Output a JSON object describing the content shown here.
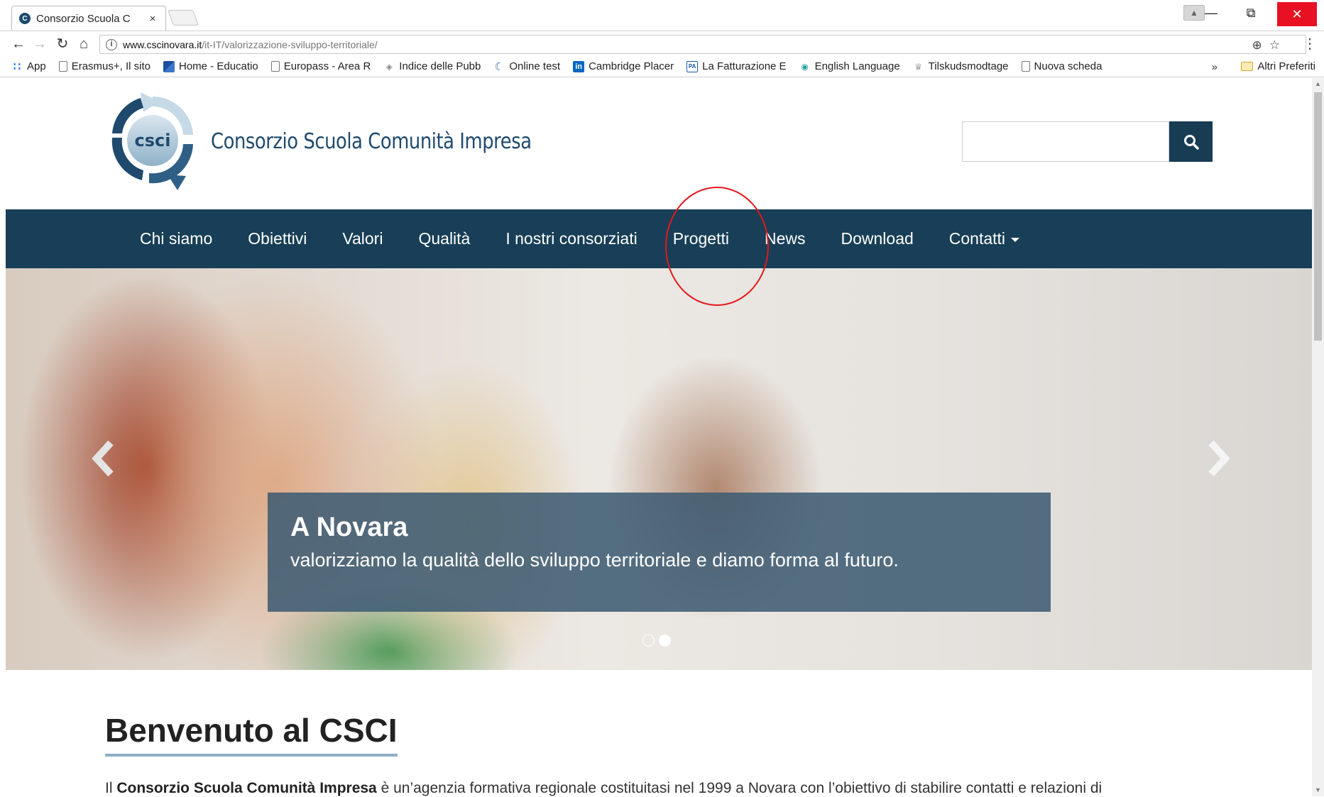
{
  "browser": {
    "tab_title": "Consorzio Scuola C",
    "tab_close": "×",
    "url_host": "www.cscinovara.it",
    "url_path": "/it-IT/valorizzazione-sviluppo-territoriale/",
    "info_symbol": "i",
    "bookmarks": [
      {
        "label": "App",
        "icon": "apps-grid-icon"
      },
      {
        "label": "Erasmus+, Il sito",
        "icon": "page-icon"
      },
      {
        "label": "Home - Educatio",
        "icon": "image-bookmark-icon"
      },
      {
        "label": "Europass - Area R",
        "icon": "page-icon"
      },
      {
        "label": "Indice delle Pubb",
        "icon": "globe-icon"
      },
      {
        "label": "Online test",
        "icon": "crescent-icon"
      },
      {
        "label": "Cambridge Placer",
        "icon": "linkedin-icon"
      },
      {
        "label": "La Fatturazione E",
        "icon": "pa-icon"
      },
      {
        "label": "English Language",
        "icon": "chat-bubble-icon"
      },
      {
        "label": "Tilskudsmodtage",
        "icon": "crown-icon"
      },
      {
        "label": "Nuova scheda",
        "icon": "page-icon"
      }
    ],
    "bookmarks_more": "»",
    "other_bookmarks": "Altri Preferiti"
  },
  "site": {
    "logo_abbr": "csci",
    "logo_name": "Consorzio Scuola Comunità Impresa",
    "search_placeholder": ""
  },
  "nav": {
    "items": [
      "Chi siamo",
      "Obiettivi",
      "Valori",
      "Qualità",
      "I nostri consorziati",
      "Progetti",
      "News",
      "Download",
      "Contatti"
    ]
  },
  "hero": {
    "title": "A Novara",
    "subtitle": "valorizziamo la qualità dello sviluppo territoriale e diamo forma al futuro.",
    "slides_total": 2,
    "active_slide": 2
  },
  "content": {
    "heading": "Benvenuto al CSCI",
    "intro_prefix": "Il ",
    "intro_bold": "Consorzio Scuola Comunità Impresa",
    "intro_rest": " è un’agenzia formativa regionale costituitasi nel 1999 a Novara con l’obiettivo di stabilire contatti e relazioni di"
  },
  "colors": {
    "nav_bg": "#183f57",
    "brand_blue": "#1f4a6e",
    "annotation_red": "#e3171c",
    "caption_bg": "#3f5c73"
  }
}
